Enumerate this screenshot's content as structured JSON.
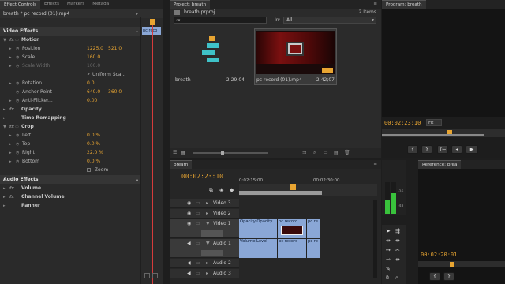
{
  "effect_controls": {
    "tabs": [
      "Effect Controls",
      "Effects",
      "Markers",
      "Metada"
    ],
    "source_label": "breath * pc record (01).mp4",
    "clip_label": "pc reco",
    "video_effects": "Video Effects",
    "motion": "Motion",
    "position_label": "Position",
    "position_x": "1225.0",
    "position_y": "521.0",
    "scale_label": "Scale",
    "scale_value": "160.0",
    "scale_width_label": "Scale Width",
    "scale_width_value": "100.0",
    "uniform_scale": "Uniform Sca...",
    "rotation_label": "Rotation",
    "rotation_value": "0.0",
    "anchor_label": "Anchor Point",
    "anchor_x": "640.0",
    "anchor_y": "360.0",
    "antiflicker_label": "Anti-Flicker...",
    "antiflicker_value": "0.00",
    "opacity": "Opacity",
    "time_remapping": "Time Remapping",
    "crop": "Crop",
    "left_label": "Left",
    "left_value": "0.0 %",
    "top_label": "Top",
    "top_value": "0.0 %",
    "right_label": "Right",
    "right_value": "22.0 %",
    "bottom_label": "Bottom",
    "bottom_value": "0.0 %",
    "zoom": "Zoom",
    "audio_effects": "Audio Effects",
    "volume": "Volume",
    "channel_volume": "Channel Volume",
    "panner": "Panner"
  },
  "project": {
    "tab": "Project: breath",
    "name": "breath.prproj",
    "items_count": "2 Items",
    "in_label": "In:",
    "in_value": "All",
    "item1_name": "breath",
    "item1_duration": "2;29;04",
    "item2_name": "pc record (01).mp4",
    "item2_duration": "2;42;07"
  },
  "program": {
    "tab": "Program: breath",
    "timecode": "00:02:23:10",
    "fit": "Fit"
  },
  "timeline": {
    "tab": "breath",
    "timecode": "00:02:23:10",
    "ruler1": "0:02:15:00",
    "ruler2": "00:02:30:00",
    "tracks": [
      "Video 3",
      "Video 2",
      "Video 1",
      "Audio 1",
      "Audio 2",
      "Audio 3"
    ],
    "clip_v1a": "Opacity:Opacity",
    "clip_v1b": "pc record",
    "clip_v1c": "pc re",
    "clip_a1a": "Volume:Level",
    "clip_a1b": "pc record",
    "clip_a1c": "pc re"
  },
  "meters": {
    "label1": "-26",
    "label2": "-48"
  },
  "reference": {
    "tab": "Reference: brea",
    "timecode": "00:02:20:01"
  }
}
